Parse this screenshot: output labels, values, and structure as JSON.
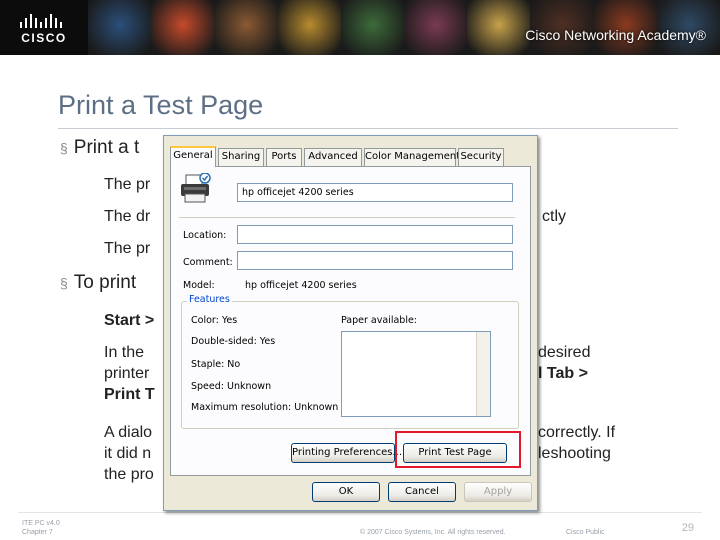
{
  "banner": {
    "brand": "CISCO",
    "academy_text": "Cisco Networking Academy®",
    "photo_tints": [
      "#2b4f7a",
      "#c64a2b",
      "#8a5a32",
      "#b88b2e",
      "#3d6b3a",
      "#7a3a52",
      "#c7a24a",
      "#4f2f22",
      "#8b3a20",
      "#2f4a66"
    ]
  },
  "slide": {
    "title": "Print a Test Page",
    "bullet1": "Print a t",
    "sub1": "The pr",
    "sub2_left": "The dr",
    "sub2_right": "ctly",
    "sub3": "The pr",
    "bullet2": "To print",
    "sub4": "Start >",
    "sub5_left_line1": "In the",
    "sub5_left_line2": "printer",
    "sub5_left_line3": "Print T",
    "sub5_right_line1": "desired",
    "sub5_right_line2": "l Tab >",
    "sub6_left_line1": "A dialo",
    "sub6_left_line2": "it did n",
    "sub6_left_line3": "the pro",
    "sub6_right_line1": "correctly. If",
    "sub6_right_line2": "leshooting"
  },
  "footer": {
    "left_line1": "ITE PC v4.0",
    "left_line2": "Chapter 7",
    "center": "© 2007 Cisco Systems, Inc. All rights reserved.",
    "right": "Cisco Public",
    "page": "29"
  },
  "dialog": {
    "tabs": [
      "General",
      "Sharing",
      "Ports",
      "Advanced",
      "Color Management",
      "Security"
    ],
    "active_tab": "General",
    "printer_name": "hp officejet 4200 series",
    "location_label": "Location:",
    "location_value": "",
    "comment_label": "Comment:",
    "comment_value": "",
    "model_label": "Model:",
    "model_value": "hp officejet 4200 series",
    "features_label": "Features",
    "color": "Color: Yes",
    "double_sided": "Double-sided: Yes",
    "staple": "Staple: No",
    "speed": "Speed: Unknown",
    "max_resolution": "Maximum resolution: Unknown",
    "paper_available": "Paper available:",
    "printing_preferences_button": "Printing Preferences...",
    "print_test_page_button": "Print Test Page",
    "ok_button": "OK",
    "cancel_button": "Cancel",
    "apply_button": "Apply",
    "highlight_color": "#e2182b"
  }
}
